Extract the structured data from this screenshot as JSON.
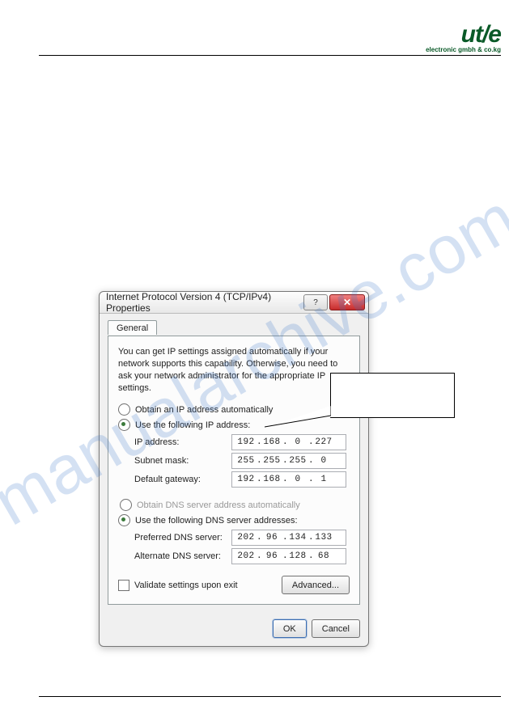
{
  "header": {
    "logo_main": "ut/e",
    "logo_sub": "electronic gmbh & co.kg"
  },
  "watermark": "manualarchive.com",
  "dialog": {
    "title": "Internet Protocol Version 4 (TCP/IPv4) Properties",
    "tab": "General",
    "intro": "You can get IP settings assigned automatically if your network supports this capability. Otherwise, you need to ask your network administrator for the appropriate IP settings.",
    "radio_auto_ip": "Obtain an IP address automatically",
    "radio_static_ip": "Use the following IP address:",
    "ip_label": "IP address:",
    "ip": [
      "192",
      "168",
      "0",
      "227"
    ],
    "mask_label": "Subnet mask:",
    "mask": [
      "255",
      "255",
      "255",
      "0"
    ],
    "gw_label": "Default gateway:",
    "gw": [
      "192",
      "168",
      "0",
      "1"
    ],
    "radio_auto_dns": "Obtain DNS server address automatically",
    "radio_static_dns": "Use the following DNS server addresses:",
    "pdns_label": "Preferred DNS server:",
    "pdns": [
      "202",
      "96",
      "134",
      "133"
    ],
    "adns_label": "Alternate DNS server:",
    "adns": [
      "202",
      "96",
      "128",
      "68"
    ],
    "validate": "Validate settings upon exit",
    "advanced": "Advanced...",
    "ok": "OK",
    "cancel": "Cancel"
  }
}
